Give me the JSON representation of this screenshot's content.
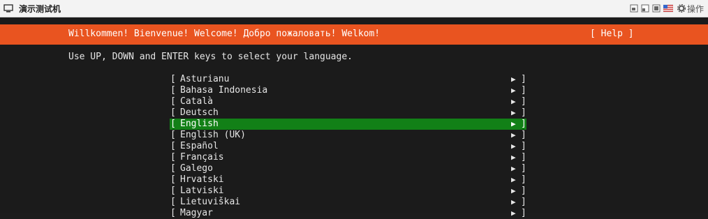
{
  "window": {
    "title": "演示测试机",
    "ops_label": "操作"
  },
  "banner": {
    "welcome": "Willkommen! Bienvenue! Welcome! Добро пожаловать! Welkom!",
    "help": "[ Help ]"
  },
  "instructions": "Use UP, DOWN and ENTER keys to select your language.",
  "menu": {
    "open_bracket": "[",
    "close_bracket": "]",
    "arrow": "▶",
    "selected_index": 4,
    "items": [
      "Asturianu",
      "Bahasa Indonesia",
      "Català",
      "Deutsch",
      "English",
      "English (UK)",
      "Español",
      "Français",
      "Galego",
      "Hrvatski",
      "Latviski",
      "Lietuviškai",
      "Magyar"
    ]
  },
  "colors": {
    "banner": "#e95420",
    "selected": "#128017",
    "background": "#1b1b1b"
  }
}
